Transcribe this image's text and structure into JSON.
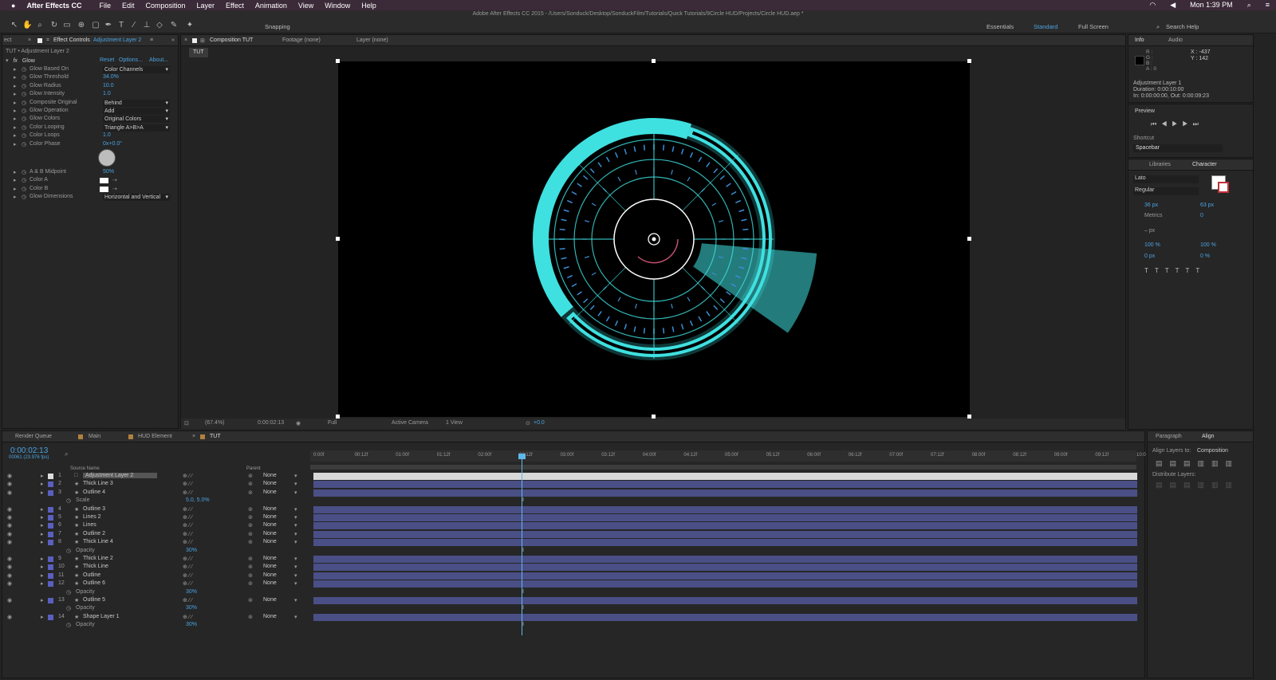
{
  "menubar": {
    "app": "After Effects CC",
    "items": [
      "File",
      "Edit",
      "Composition",
      "Layer",
      "Effect",
      "Animation",
      "View",
      "Window",
      "Help"
    ],
    "clock": "Mon 1:39 PM"
  },
  "title": "Adobe After Effects CC 2015 - /Users/Sonduck/Desktop/SonduckFilm/Tutorials/Quick Tutorials/9Circle HUD/Projects/Circle HUD.aep *",
  "toolbar": {
    "snapping": "Snapping",
    "workspaces": [
      "Essentials",
      "Standard",
      "Full Screen"
    ],
    "search": "Search Help"
  },
  "effect_controls": {
    "tab_prefix": "ect",
    "tab": "Effect Controls",
    "tab_layer": "Adjustment Layer 2",
    "breadcrumb": "TUT • Adjustment Layer 2",
    "effect": "Glow",
    "reset": "Reset",
    "options": "Options...",
    "about": "About...",
    "props": [
      {
        "name": "Glow Based On",
        "value": "Color Channels",
        "type": "dd"
      },
      {
        "name": "Glow Threshold",
        "value": "34.0%",
        "type": "val"
      },
      {
        "name": "Glow Radius",
        "value": "10.0",
        "type": "val"
      },
      {
        "name": "Glow Intensity",
        "value": "1.0",
        "type": "val"
      },
      {
        "name": "Composite Original",
        "value": "Behind",
        "type": "dd"
      },
      {
        "name": "Glow Operation",
        "value": "Add",
        "type": "dd"
      },
      {
        "name": "Glow Colors",
        "value": "Original Colors",
        "type": "dd"
      },
      {
        "name": "Color Looping",
        "value": "Triangle A>B>A",
        "type": "dd"
      },
      {
        "name": "Color Loops",
        "value": "1.0",
        "type": "val"
      },
      {
        "name": "Color Phase",
        "value": "0x+0.0°",
        "type": "val"
      }
    ],
    "props2": [
      {
        "name": "A & B Midpoint",
        "value": "50%",
        "type": "val"
      },
      {
        "name": "Color A",
        "value": "",
        "type": "color"
      },
      {
        "name": "Color B",
        "value": "",
        "type": "color"
      },
      {
        "name": "Glow Dimensions",
        "value": "Horizontal and Vertical",
        "type": "dd"
      }
    ]
  },
  "composition": {
    "tabs": [
      "Composition TUT",
      "Footage (none)",
      "Layer (none)"
    ],
    "chip": "TUT",
    "footer": {
      "zoom": "(67.4%)",
      "time": "0:00:02:13",
      "res": "Full",
      "camera": "Active Camera",
      "view": "1 View",
      "exposure": "+0.0"
    }
  },
  "info": {
    "tabs": [
      "Info",
      "Audio"
    ],
    "rgb": [
      "R :",
      "G :",
      "B :",
      "A : 0"
    ],
    "xy": [
      "X : -437",
      "Y : 142"
    ],
    "layer": "Adjustment Layer 1",
    "duration": "Duration: 0:00:10:00",
    "inout": "In: 0:00:00:00, Out: 0:00:09:23"
  },
  "preview": {
    "title": "Preview",
    "shortcut_label": "Shortcut",
    "shortcut": "Spacebar"
  },
  "character": {
    "tabs": [
      "Libraries",
      "Character"
    ],
    "font": "Lato",
    "style": "Regular",
    "size": "36 px",
    "leading": "63 px",
    "kerning": "Metrics",
    "tracking": "0",
    "stroke": "– px",
    "vscale": "100 %",
    "hscale": "100 %",
    "baseline": "0 px",
    "tsume": "0 %"
  },
  "timeline": {
    "tabs": [
      "Render Queue",
      "Main",
      "HUD Element",
      "TUT"
    ],
    "time": "0:00:02:13",
    "frames": "00061 (23.976 fps)",
    "col_source": "Source Name",
    "col_parent": "Parent",
    "ticks": [
      "0:00f",
      "00:12f",
      "01:00f",
      "01:12f",
      "02:00f",
      "02:12f",
      "03:00f",
      "03:12f",
      "04:00f",
      "04:12f",
      "05:00f",
      "05:12f",
      "06:00f",
      "06:12f",
      "07:00f",
      "07:12f",
      "08:00f",
      "08:12f",
      "09:00f",
      "09:12f",
      "10:0"
    ],
    "layers": [
      {
        "num": "1",
        "name": "Adjustment Layer 2",
        "parent": "None",
        "kind": "layer"
      },
      {
        "num": "2",
        "name": "Thick Line 3",
        "parent": "None",
        "kind": "layer"
      },
      {
        "num": "3",
        "name": "Outline 4",
        "parent": "None",
        "kind": "layer"
      },
      {
        "num": "",
        "name": "Scale",
        "parent": "5.0, 5.0%",
        "kind": "sub"
      },
      {
        "num": "4",
        "name": "Outline 3",
        "parent": "None",
        "kind": "layer"
      },
      {
        "num": "5",
        "name": "Lines 2",
        "parent": "None",
        "kind": "layer"
      },
      {
        "num": "6",
        "name": "Lines",
        "parent": "None",
        "kind": "layer"
      },
      {
        "num": "7",
        "name": "Outline 2",
        "parent": "None",
        "kind": "layer"
      },
      {
        "num": "8",
        "name": "Thick Line 4",
        "parent": "None",
        "kind": "layer"
      },
      {
        "num": "",
        "name": "Opacity",
        "parent": "30%",
        "kind": "sub"
      },
      {
        "num": "9",
        "name": "Thick Line 2",
        "parent": "None",
        "kind": "layer"
      },
      {
        "num": "10",
        "name": "Thick Line",
        "parent": "None",
        "kind": "layer"
      },
      {
        "num": "11",
        "name": "Outline",
        "parent": "None",
        "kind": "layer"
      },
      {
        "num": "12",
        "name": "Outline 6",
        "parent": "None",
        "kind": "layer"
      },
      {
        "num": "",
        "name": "Opacity",
        "parent": "30%",
        "kind": "sub"
      },
      {
        "num": "13",
        "name": "Outline 5",
        "parent": "None",
        "kind": "layer"
      },
      {
        "num": "",
        "name": "Opacity",
        "parent": "30%",
        "kind": "sub"
      },
      {
        "num": "14",
        "name": "Shape Layer 1",
        "parent": "None",
        "kind": "layer"
      },
      {
        "num": "",
        "name": "Opacity",
        "parent": "30%",
        "kind": "sub"
      }
    ]
  },
  "align": {
    "tabs": [
      "Paragraph",
      "Align"
    ],
    "align_to_label": "Align Layers to:",
    "align_to": "Composition",
    "distribute": "Distribute Layers:"
  },
  "colors": {
    "accent": "#4aa3e0",
    "hud": "#3fe0e0",
    "bar": "#4a4f86",
    "menubar": "#3b2a38"
  }
}
